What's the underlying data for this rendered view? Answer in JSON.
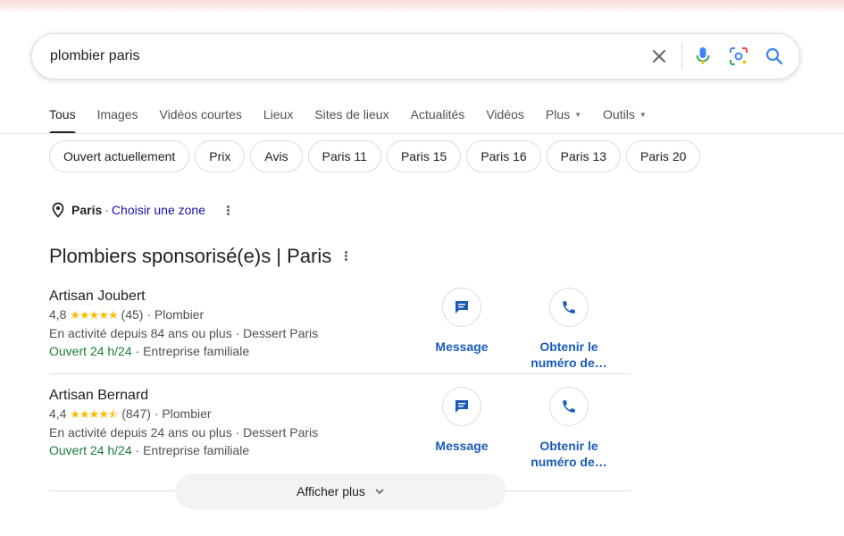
{
  "search": {
    "query": "plombier paris"
  },
  "tabs": [
    {
      "label": "Tous",
      "active": true
    },
    {
      "label": "Images"
    },
    {
      "label": "Vidéos courtes"
    },
    {
      "label": "Lieux"
    },
    {
      "label": "Sites de lieux"
    },
    {
      "label": "Actualités"
    },
    {
      "label": "Vidéos"
    },
    {
      "label": "Plus",
      "dropdown": true
    },
    {
      "label": "Outils",
      "dropdown": true
    }
  ],
  "chips": [
    "Ouvert actuellement",
    "Prix",
    "Avis",
    "Paris 11",
    "Paris 15",
    "Paris 16",
    "Paris 13",
    "Paris 20"
  ],
  "location": {
    "city": "Paris",
    "separator": "·",
    "choose": "Choisir une zone"
  },
  "section_title": "Plombiers sponsorisé(e)s | Paris",
  "listings": [
    {
      "name": "Artisan Joubert",
      "rating": "4,8",
      "stars": "★★★★★",
      "rating_value": 4.8,
      "reviews": "(45)",
      "category": "· Plombier",
      "line2": "En activité depuis 84 ans ou plus · Dessert Paris",
      "hours": "Ouvert 24 h/24",
      "extra": " · Entreprise familiale",
      "message_label": "Message",
      "call_label_1": "Obtenir le",
      "call_label_2": "numéro de…"
    },
    {
      "name": "Artisan Bernard",
      "rating": "4,4",
      "stars": "★★★★⯪",
      "rating_value": 4.4,
      "reviews": "(847)",
      "category": "· Plombier",
      "line2": "En activité depuis 24 ans ou plus · Dessert Paris",
      "hours": "Ouvert 24 h/24",
      "extra": " · Entreprise familiale",
      "message_label": "Message",
      "call_label_1": "Obtenir le",
      "call_label_2": "numéro de…"
    }
  ],
  "more_button": "Afficher plus",
  "colors": {
    "link": "#1a0dab",
    "action": "#1a5bb8",
    "open": "#188038",
    "star": "#fbbc04"
  },
  "icons": [
    "close-icon",
    "mic-icon",
    "lens-icon",
    "search-icon",
    "location-pin-icon",
    "more-vert-icon",
    "message-icon",
    "phone-icon",
    "chevron-down-icon"
  ]
}
